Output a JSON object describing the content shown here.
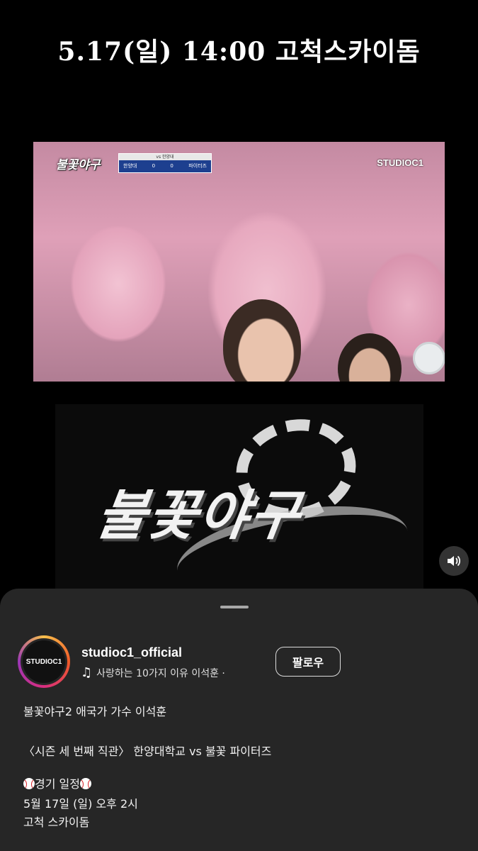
{
  "header": {
    "title": "5.17(일) 14:00 고척스카이돔"
  },
  "video": {
    "overlay_logo": "불꽃야구",
    "scoreboard": {
      "top": "vs 한양대",
      "home_team": "한양대",
      "home_score": "0",
      "away_score": "0",
      "away_team": "파이터즈"
    },
    "watermark": "STUDIOC1"
  },
  "promo": {
    "logo_text": "불꽃야구"
  },
  "controls": {
    "volume_icon": "speaker-icon"
  },
  "post": {
    "avatar_label": "STUDIOC1",
    "username": "studioc1_official",
    "music": "사랑하는 10가지 이유   이석훈 ·",
    "follow_label": "팔로우",
    "caption": {
      "line1": "불꽃야구2 애국가 가수 이석훈",
      "line2": "〈시즌 세 번째 직관〉 한양대학교 vs 불꽃 파이터즈",
      "schedule_label": "경기 일정",
      "date_line": "5월 17일 (일) 오후 2시",
      "venue_line": "고척 스카이돔"
    }
  }
}
